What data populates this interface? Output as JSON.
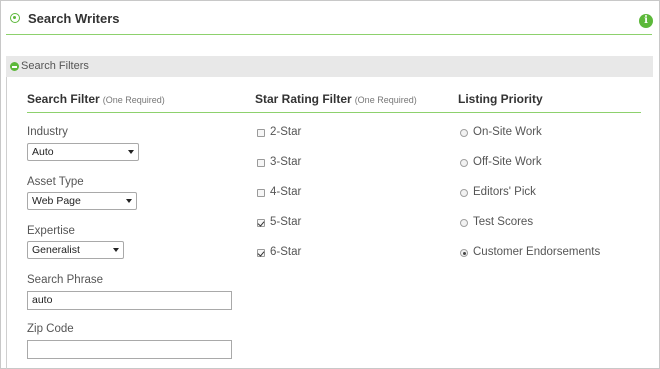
{
  "header": {
    "title": "Search Writers",
    "info_icon": "info-icon"
  },
  "filters_bar": {
    "label": "Search Filters"
  },
  "columns": {
    "search_filter": {
      "title": "Search Filter",
      "note": "(One Required)"
    },
    "star_rating": {
      "title": "Star Rating Filter",
      "note": "(One Required)"
    },
    "listing_priority": {
      "title": "Listing Priority"
    }
  },
  "fields": {
    "industry": {
      "label": "Industry",
      "value": "Auto"
    },
    "asset_type": {
      "label": "Asset Type",
      "value": "Web Page"
    },
    "expertise": {
      "label": "Expertise",
      "value": "Generalist"
    },
    "search_phrase": {
      "label": "Search Phrase",
      "value": "auto"
    },
    "zip_code": {
      "label": "Zip Code",
      "value": ""
    }
  },
  "star_options": [
    {
      "label": "2-Star",
      "checked": false
    },
    {
      "label": "3-Star",
      "checked": false
    },
    {
      "label": "4-Star",
      "checked": false
    },
    {
      "label": "5-Star",
      "checked": true
    },
    {
      "label": "6-Star",
      "checked": true
    }
  ],
  "priority_options": [
    {
      "label": "On-Site Work",
      "selected": false
    },
    {
      "label": "Off-Site Work",
      "selected": false
    },
    {
      "label": "Editors' Pick",
      "selected": false
    },
    {
      "label": "Test Scores",
      "selected": false
    },
    {
      "label": "Customer Endorsements",
      "selected": true
    }
  ],
  "colors": {
    "accent": "#5cb83a",
    "rule": "#8dd16d",
    "bar_bg": "#e8e8e8"
  }
}
